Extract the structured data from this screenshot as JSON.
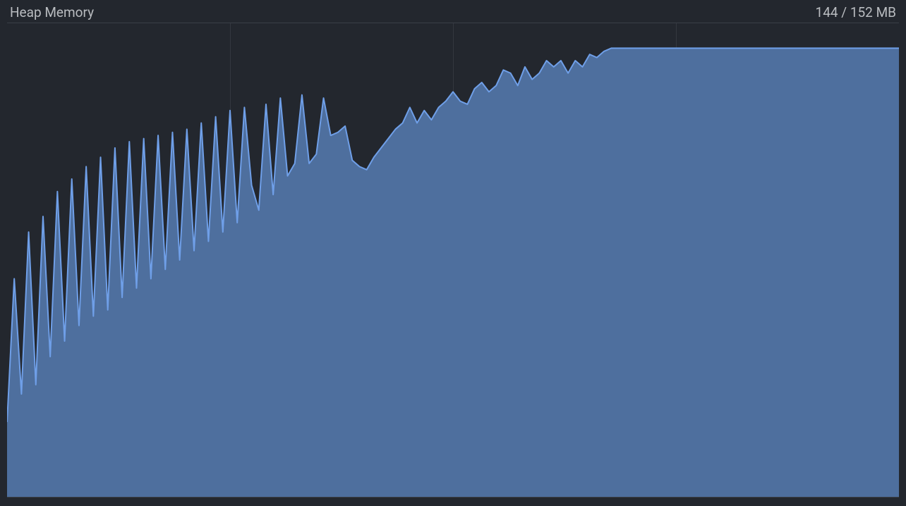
{
  "header": {
    "title": "Heap Memory",
    "usage": "144 / 152 MB"
  },
  "chart_data": {
    "type": "area",
    "title": "Heap Memory",
    "xlabel": "",
    "ylabel": "",
    "ylim": [
      0,
      152
    ],
    "grid_x_count": 4,
    "series": [
      {
        "name": "heap",
        "line_color": "#6f9fe8",
        "fill_color": "#4e6f9e",
        "values": [
          24,
          70,
          33,
          85,
          36,
          90,
          45,
          98,
          50,
          102,
          55,
          106,
          58,
          109,
          60,
          112,
          64,
          114,
          67,
          115,
          70,
          116,
          73,
          117,
          76,
          118,
          79,
          120,
          82,
          122,
          85,
          124,
          88,
          125,
          100,
          92,
          126,
          97,
          128,
          103,
          107,
          129,
          107,
          110,
          128,
          116,
          117,
          119,
          108,
          106,
          105,
          109,
          112,
          115,
          118,
          120,
          125,
          120,
          124,
          121,
          125,
          127,
          130,
          127,
          126,
          131,
          133,
          130,
          132,
          137,
          136,
          132,
          138,
          134,
          136,
          140,
          138,
          140,
          136,
          140,
          138,
          142,
          141,
          143,
          144,
          144,
          144,
          144,
          144,
          144,
          144,
          144,
          144,
          144,
          144,
          144,
          144,
          144,
          144,
          144,
          144,
          144,
          144,
          144,
          144,
          144,
          144,
          144,
          144,
          144,
          144,
          144,
          144,
          144,
          144,
          144,
          144,
          144,
          144,
          144,
          144,
          144,
          144,
          144,
          144
        ]
      }
    ]
  }
}
